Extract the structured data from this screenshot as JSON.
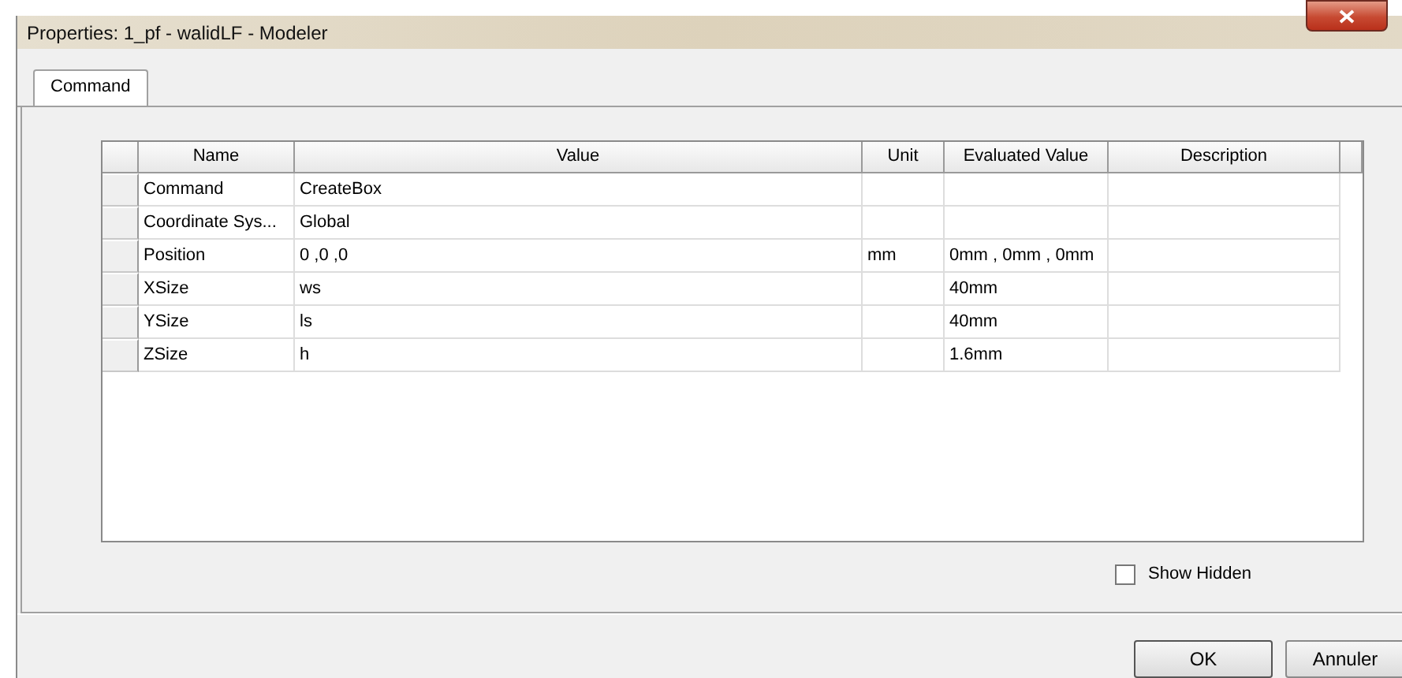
{
  "window": {
    "title": "Properties: 1_pf - walidLF - Modeler"
  },
  "tabs": [
    {
      "label": "Command",
      "selected": true
    }
  ],
  "table": {
    "columns": [
      "Name",
      "Value",
      "Unit",
      "Evaluated Value",
      "Description"
    ],
    "rows": [
      {
        "cells": [
          "Command",
          "CreateBox",
          "",
          "",
          ""
        ]
      },
      {
        "cells": [
          "Coordinate Sys...",
          "Global",
          "",
          "",
          ""
        ]
      },
      {
        "cells": [
          "Position",
          "0 ,0 ,0",
          "mm",
          "0mm , 0mm , 0mm",
          ""
        ]
      },
      {
        "cells": [
          "XSize",
          "ws",
          "",
          "40mm",
          ""
        ]
      },
      {
        "cells": [
          "YSize",
          "ls",
          "",
          "40mm",
          ""
        ]
      },
      {
        "cells": [
          "ZSize",
          "h",
          "",
          "1.6mm",
          ""
        ]
      }
    ]
  },
  "show_hidden": {
    "label": "Show Hidden",
    "checked": false
  },
  "buttons": [
    "OK",
    "Annuler"
  ]
}
